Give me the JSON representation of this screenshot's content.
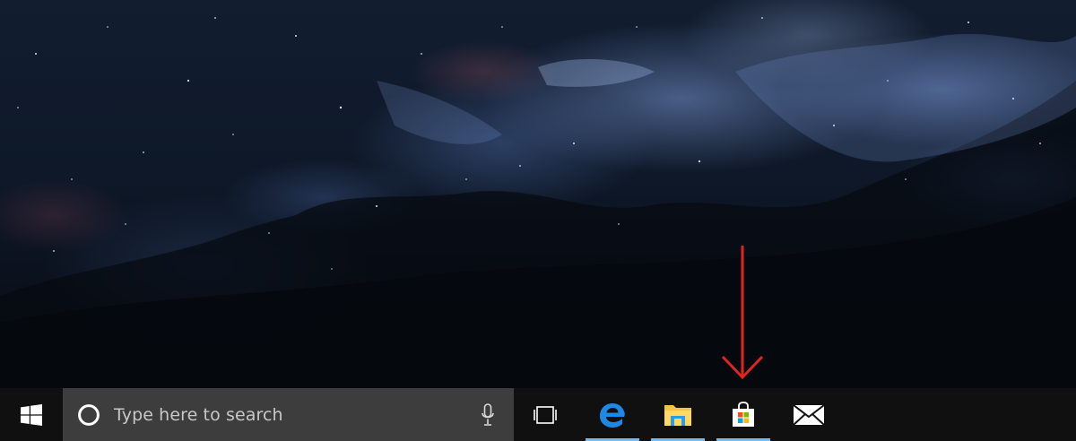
{
  "taskbar": {
    "start": {
      "icon": "windows-logo-icon"
    },
    "search": {
      "placeholder": "Type here to search",
      "icon": "cortana-icon",
      "mic_icon": "microphone-icon"
    },
    "task_view": {
      "icon": "task-view-icon"
    },
    "pinned_apps": [
      {
        "name": "Microsoft Edge",
        "icon": "edge-icon",
        "running": true
      },
      {
        "name": "File Explorer",
        "icon": "folder-icon",
        "running": true
      },
      {
        "name": "Microsoft Store",
        "icon": "store-icon",
        "running": true
      },
      {
        "name": "Mail",
        "icon": "mail-icon",
        "running": false
      }
    ],
    "accent_color": "#76b9ed",
    "background_color": "#101010"
  },
  "annotation": {
    "type": "arrow",
    "color": "#e02424",
    "points_to": "Microsoft Store"
  }
}
